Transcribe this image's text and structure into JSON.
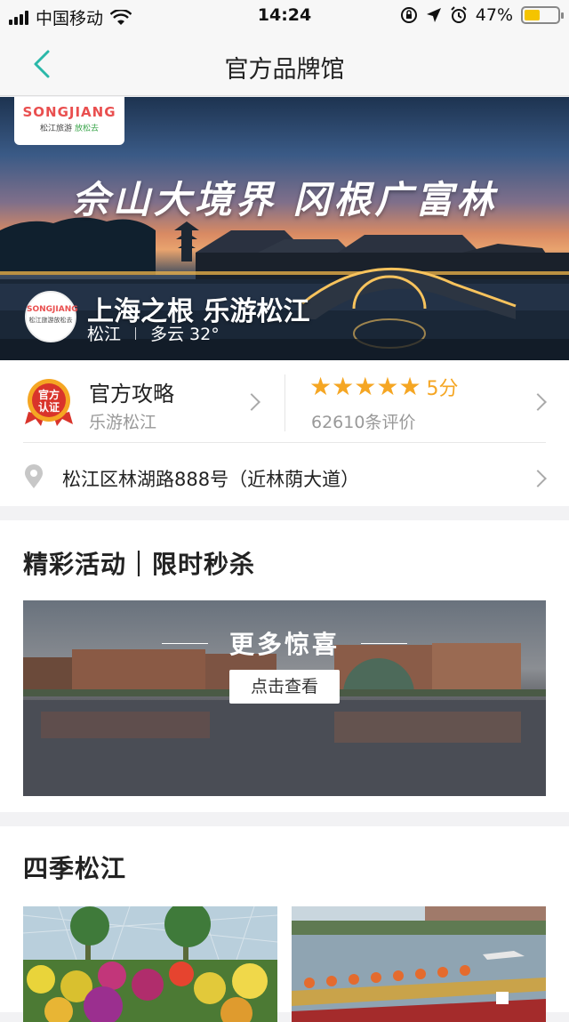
{
  "status_bar": {
    "carrier": "中国移动",
    "time": "14:24",
    "battery": "47%",
    "battery_level": 0.47
  },
  "nav": {
    "title": "官方品牌馆"
  },
  "hero": {
    "logo_top": "SONGJIANG",
    "logo_sub_left": "松江旅游",
    "logo_sub_right": "放松去",
    "slogan": "佘山大境界 冈根广富林",
    "destination_name": "上海之根 乐游松江",
    "location": "松江",
    "weather": "多云 32°"
  },
  "info": {
    "cert_badge": "官方认证",
    "guide_title": "官方攻略",
    "guide_subtitle": "乐游松江",
    "rating_stars": 5,
    "rating_score": "5分",
    "reviews": "62610条评价",
    "address": "松江区林湖路888号（近林荫大道）"
  },
  "activities": {
    "title": "精彩活动｜限时秒杀",
    "banner_text": "更多惊喜",
    "banner_button": "点击查看"
  },
  "seasons": {
    "title": "四季松江"
  },
  "colors": {
    "accent": "#2bb8a9",
    "star": "#f5a623",
    "battery": "#f5c400"
  }
}
